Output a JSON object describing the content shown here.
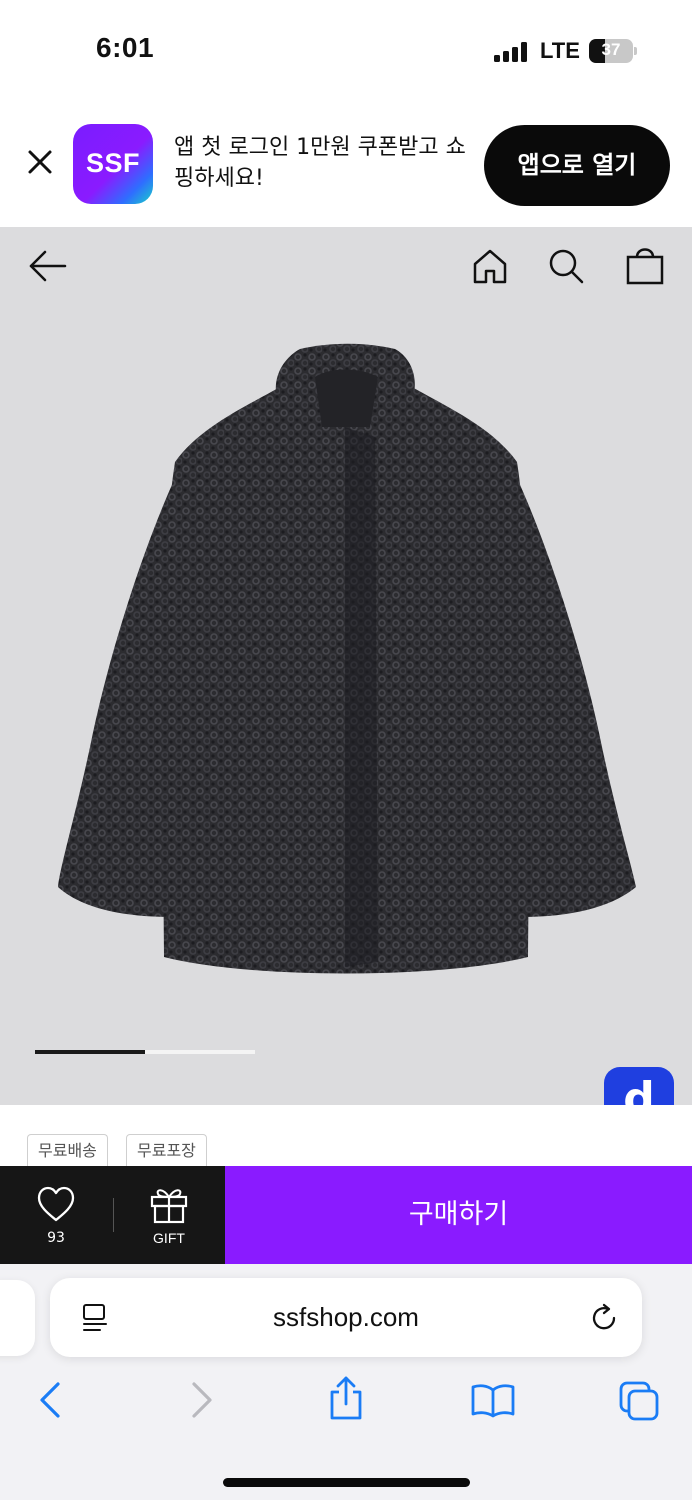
{
  "status_bar": {
    "time": "6:01",
    "network": "LTE",
    "battery_percent": "37",
    "battery_level": 0.37
  },
  "app_banner": {
    "logo_text": "SSF",
    "message": "앱 첫 로그인 1만원 쿠폰받고 쇼핑하세요!",
    "open_button": "앱으로 열기",
    "close_icon": "close-icon",
    "logo_colors": [
      "#7a1cff",
      "#2f6dff",
      "#18d0c8"
    ]
  },
  "product": {
    "nav_icons": [
      "back-arrow-icon",
      "home-icon",
      "search-icon",
      "shopping-bag-icon"
    ],
    "image_subject": "charcoal-curly-fur-jacket",
    "image_count": 2,
    "current_image": 1,
    "floating_badge": "d",
    "background_color": "#dcdcde"
  },
  "tags": [
    "무료배송",
    "무료포장"
  ],
  "purchase_bar": {
    "like_count": "93",
    "gift_label": "GIFT",
    "buy_label": "구매하기",
    "buy_color": "#8a1bff"
  },
  "safari": {
    "url": "ssfshop.com",
    "toolbar_icons": [
      "back-icon",
      "forward-icon",
      "share-icon",
      "bookmarks-icon",
      "tabs-icon"
    ],
    "accent_color": "#1a7cf5"
  }
}
